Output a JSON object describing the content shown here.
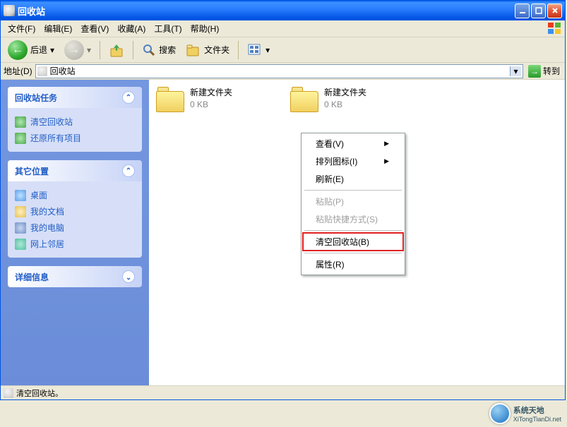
{
  "window": {
    "title": "回收站"
  },
  "menu": {
    "file": "文件(F)",
    "edit": "编辑(E)",
    "view": "查看(V)",
    "fav": "收藏(A)",
    "tools": "工具(T)",
    "help": "帮助(H)"
  },
  "toolbar": {
    "back": "后退",
    "search": "搜索",
    "folders": "文件夹"
  },
  "address": {
    "label": "地址(D)",
    "value": "回收站",
    "go": "转到"
  },
  "sidebar": {
    "tasks": {
      "title": "回收站任务",
      "items": [
        {
          "label": "清空回收站",
          "color": "#4aa84a"
        },
        {
          "label": "还原所有项目",
          "color": "#4aa84a"
        }
      ]
    },
    "places": {
      "title": "其它位置",
      "items": [
        {
          "label": "桌面",
          "color": "#58a0e8"
        },
        {
          "label": "我的文档",
          "color": "#e6c050"
        },
        {
          "label": "我的电脑",
          "color": "#7090c8"
        },
        {
          "label": "网上邻居",
          "color": "#50c0a0"
        }
      ]
    },
    "details": {
      "title": "详细信息"
    }
  },
  "files": [
    {
      "name": "新建文件夹",
      "size": "0 KB"
    },
    {
      "name": "新建文件夹",
      "size": "0 KB"
    }
  ],
  "context": {
    "view": "查看(V)",
    "arrange": "排列图标(I)",
    "refresh": "刷新(E)",
    "paste": "粘贴(P)",
    "paste_shortcut": "粘贴快捷方式(S)",
    "empty": "清空回收站(B)",
    "props": "属性(R)"
  },
  "status": "清空回收站。",
  "watermark": {
    "line1": "系统天地",
    "line2": "XiTongTianDi.net"
  }
}
